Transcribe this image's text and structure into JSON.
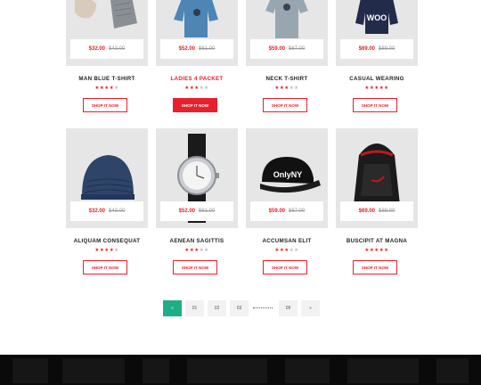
{
  "products": [
    {
      "name": "MAN BLUE T-SHIRT",
      "price": "$32.00",
      "old_price": "$43.00",
      "rating": 4,
      "button": "SHOP IT NOW",
      "image": "shoes-and-sweater"
    },
    {
      "name": "LADIES 4 PACKET",
      "price": "$52.00",
      "old_price": "$61.00",
      "rating": 3,
      "button": "SHOP IT NOW",
      "image": "blue-hoodie"
    },
    {
      "name": "NECK T-SHIRT",
      "price": "$59.00",
      "old_price": "$67.00",
      "rating": 3,
      "button": "SHOP IT NOW",
      "image": "grey-t-shirt"
    },
    {
      "name": "CASUAL WEARING",
      "price": "$69.00",
      "old_price": "$88.00",
      "rating": 5,
      "button": "SHOP IT NOW",
      "image": "navy-hoodie",
      "print": "WOO"
    },
    {
      "name": "ALIQUAM CONSEQUAT",
      "price": "$32.00",
      "old_price": "$43.00",
      "rating": 4,
      "button": "SHOP IT NOW",
      "image": "blue-beanie"
    },
    {
      "name": "AENEAN SAGITTIS",
      "price": "$52.00",
      "old_price": "$61.00",
      "rating": 3,
      "button": "SHOP IT NOW",
      "image": "wrist-watch"
    },
    {
      "name": "ACCUMSAN ELIT",
      "price": "$59.00",
      "old_price": "$67.00",
      "rating": 3,
      "button": "SHOP IT NOW",
      "image": "black-cap",
      "print": "OnlyNY"
    },
    {
      "name": "BUSCIPIT AT MAGNA",
      "price": "$69.00",
      "old_price": "$88.00",
      "rating": 5,
      "button": "SHOP IT NOW",
      "image": "backpack"
    }
  ],
  "pagination": {
    "prev": "«",
    "pages": [
      "01",
      "02",
      "03"
    ],
    "last": "09",
    "next": "»"
  },
  "colors": {
    "accent": "#e8202d",
    "pager_active": "#1cae87",
    "card_bg": "#e6e6e6",
    "footer": "#0a0a0a"
  }
}
